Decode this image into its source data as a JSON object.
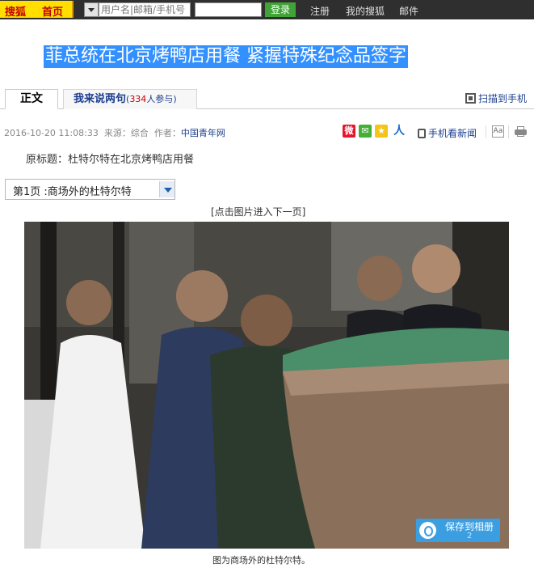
{
  "topbar": {
    "brand": "搜狐",
    "home_label": "首页",
    "account_placeholder": "用户名|邮箱/手机号",
    "login_label": "登录",
    "links": [
      "注册",
      "我的搜狐",
      "邮件"
    ]
  },
  "article": {
    "title": "菲总统在北京烤鸭店用餐  紧握特殊纪念品签字",
    "tabs": {
      "main_label": "正文",
      "comment_label": "我来说两句",
      "comment_count": "334",
      "comment_suffix": "人参与"
    },
    "scan_label": "扫描到手机",
    "meta": {
      "datetime": "2016-10-20 11:08:33",
      "source_prefix": "来源：综合",
      "author_prefix": "作者：",
      "author": "中国青年网"
    },
    "share_icons": [
      "weibo-icon",
      "wechat-icon",
      "qzone-icon",
      "renren-icon"
    ],
    "mobile_news_label": "手机看新闻",
    "original_title": "原标题：杜特尔特在北京烤鸭店用餐",
    "page_select_value": "第1页 :商场外的杜特尔特",
    "click_hint": "[点击图片进入下一页]",
    "photo_alt": "图为商场外的杜特尔特。",
    "save_album_label": "保存到相册",
    "save_album_count": "2",
    "caption": "图为商场外的杜特尔特。"
  },
  "colors": {
    "topbar_bg": "#2f2f2f",
    "logo_bg": "#ffde00",
    "title_highlight": "#3390ff",
    "login_green": "#3fa335",
    "link_blue": "#1a3d8f"
  }
}
